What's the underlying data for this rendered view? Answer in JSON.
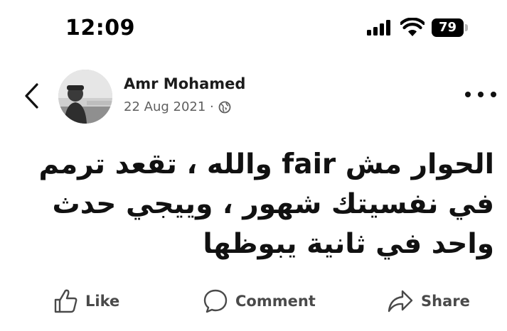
{
  "status_bar": {
    "time": "12:09",
    "battery_level": "79",
    "icons": [
      "cellular-signal-icon",
      "wifi-icon",
      "battery-icon"
    ]
  },
  "post": {
    "author": "Amr Mohamed",
    "date": "22 Aug 2021 ·",
    "audience_icon": "globe-icon",
    "text": "الحوار مش fair والله ، تقعد ترمم في نفسيتك شهور ، وييجي حدث واحد في ثانية يبوظها"
  },
  "actions": {
    "like_label": "Like",
    "comment_label": "Comment",
    "share_label": "Share"
  }
}
